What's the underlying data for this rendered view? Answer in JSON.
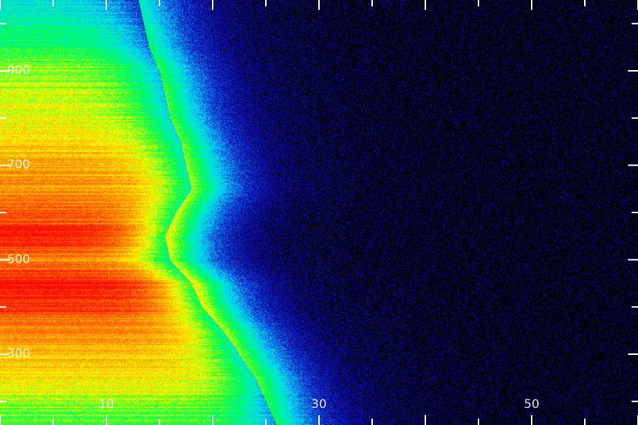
{
  "chart_data": {
    "type": "heatmap",
    "title": "",
    "xlabel": "",
    "ylabel": "",
    "x_tick_labels": [
      "10",
      "30",
      "50"
    ],
    "x_tick_values": [
      10,
      30,
      50
    ],
    "y_tick_labels": [
      "300",
      "500",
      "700",
      "900"
    ],
    "y_tick_values": [
      300,
      500,
      700,
      900
    ],
    "xlim": [
      0,
      60
    ],
    "ylim": [
      150,
      1050
    ],
    "colormap": [
      "#000000",
      "#1010c0",
      "#00e0ff",
      "#00ff40",
      "#ffff00",
      "#ff8000",
      "#ff0000"
    ],
    "intensity_profile": {
      "y": [
        1050,
        950,
        900,
        800,
        750,
        700,
        650,
        600,
        550,
        500,
        450,
        400,
        350,
        300,
        250,
        200,
        150
      ],
      "max_intensity": [
        0.35,
        0.5,
        0.6,
        0.68,
        0.72,
        0.78,
        0.82,
        0.88,
        0.98,
        0.85,
        1.0,
        0.92,
        0.82,
        0.76,
        0.7,
        0.6,
        0.5
      ],
      "edge_x": [
        13,
        14,
        15,
        16,
        17,
        17.5,
        18,
        16.5,
        15.5,
        16,
        18,
        19,
        21,
        22.5,
        24,
        25,
        26
      ]
    }
  }
}
